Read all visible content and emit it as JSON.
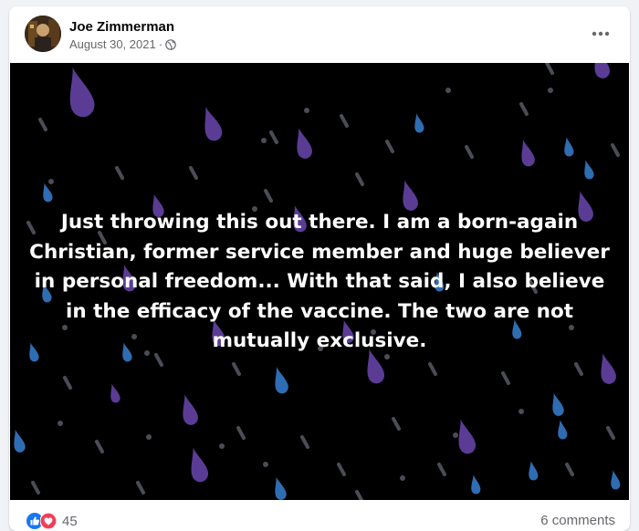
{
  "post": {
    "author": "Joe Zimmerman",
    "date": "August 30, 2021",
    "separator": "·",
    "privacy_icon": "globe-icon",
    "more_icon": "more-options-icon",
    "text": "Just throwing this out there. I am a born-again Christian, former service member and huge believer in personal freedom... With that said, I also believe in the efficacy of the vaccine. The two are not mutually exclusive.",
    "background": "rain-drops",
    "colors": {
      "background": "#000000",
      "text": "#ffffff",
      "drop_purple": "#5b3c95",
      "drop_blue": "#2f6db3",
      "drop_grey": "#4a4d55"
    }
  },
  "footer": {
    "reaction_icons": [
      "like-icon",
      "love-icon"
    ],
    "reaction_count": "45",
    "comments": "6 comments"
  }
}
